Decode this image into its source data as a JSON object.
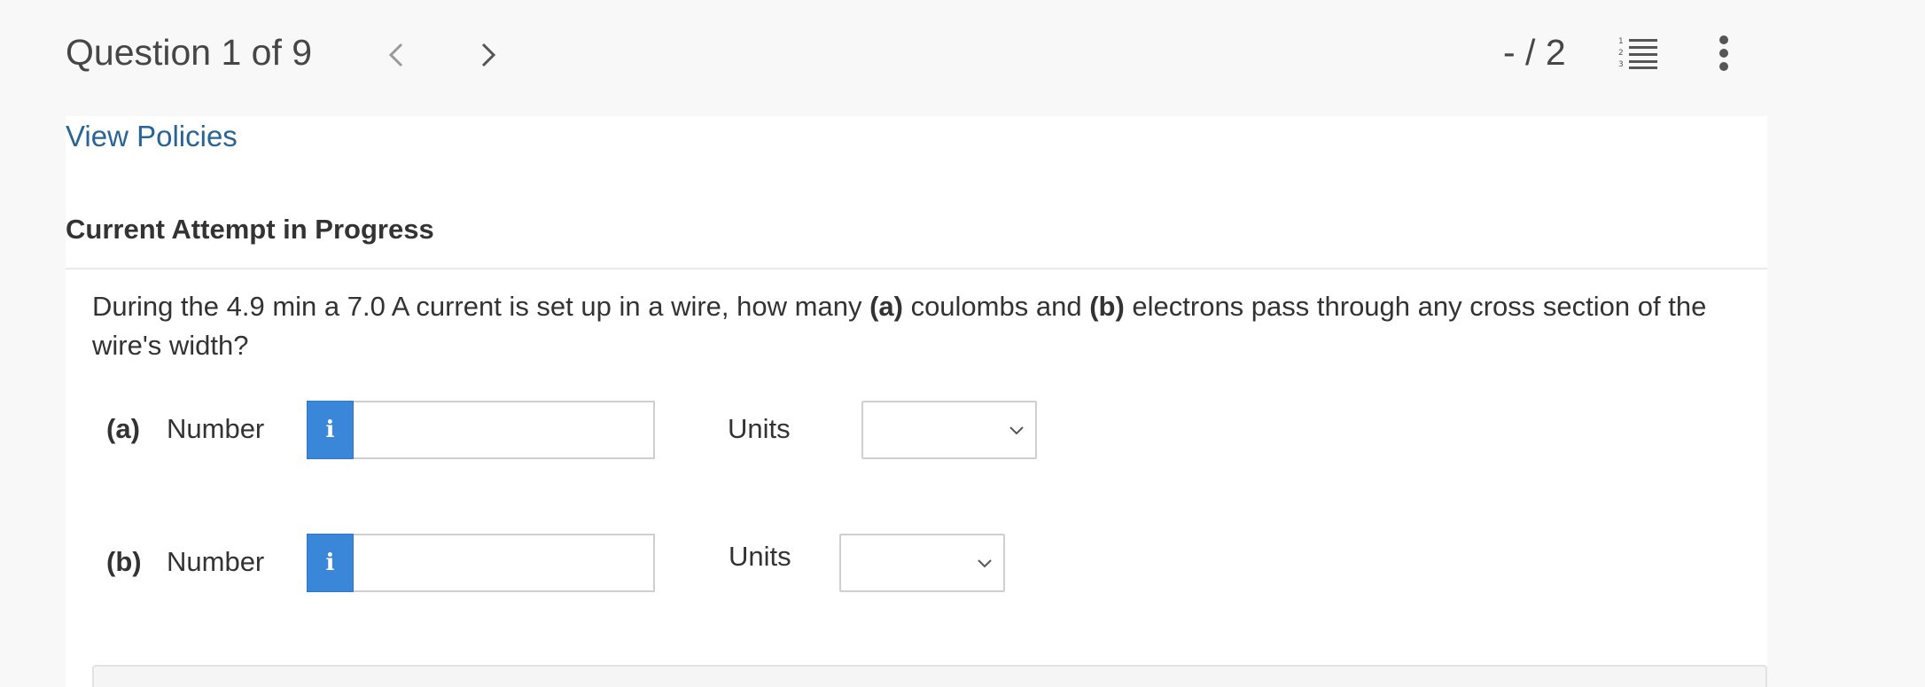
{
  "header": {
    "question_title": "Question 1 of 9",
    "score": "- / 2",
    "icons": [
      "chevron-left-icon",
      "chevron-right-icon",
      "numbered-list-icon",
      "more-vertical-icon"
    ]
  },
  "content": {
    "view_policies_link": "View Policies",
    "attempt_heading": "Current Attempt in Progress",
    "question": {
      "part1": "During the 4.9 min a 7.0 A current is set up in a wire, how many ",
      "bold_a": "(a)",
      "part2": " coulombs and ",
      "bold_b": "(b)",
      "part3": " electrons pass through any cross section of the wire's width?"
    },
    "rows": [
      {
        "part": "(a)",
        "number_label": "Number",
        "info_icon": "i",
        "number_value": "",
        "units_label": "Units",
        "units_value": ""
      },
      {
        "part": "(b)",
        "number_label": "Number",
        "info_icon": "i",
        "number_value": "",
        "units_label": "Units",
        "units_value": ""
      }
    ]
  },
  "colors": {
    "accent_blue": "#3a87d9",
    "link_blue": "#2a6496",
    "page_bg": "#f8f8f8"
  }
}
